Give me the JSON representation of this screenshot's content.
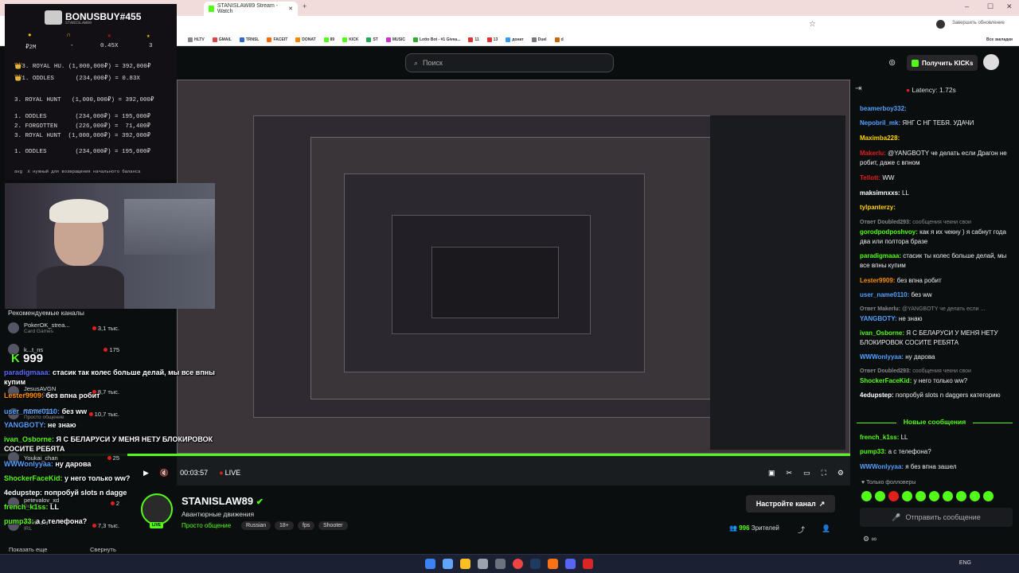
{
  "browser": {
    "active_tab": "STANISLAW89 Stream - Watch",
    "update_label": "Завершить обновление",
    "bookmarks": [
      "HLTV",
      "GMAIL",
      "TRNSL",
      "FACEIT",
      "DONAT",
      "89",
      "KICK",
      "ST",
      "MUSIC",
      "Lotto Bot - #1 Givea...",
      "11",
      "13",
      "донат",
      "Duel",
      "d"
    ],
    "all_bookmarks": "Все закладки"
  },
  "header": {
    "search_placeholder": "Поиск",
    "kicks_button": "Получить KICKs"
  },
  "bonus": {
    "title": "BONUSBUY#455",
    "subtitle": "STANISLAW89",
    "stats": [
      "₽2M",
      "-",
      "0.45X",
      "3"
    ],
    "rows": [
      "👑3. ROYAL HU. (1,000,000₽) = 392,000₽",
      "👑1. ODDLES      (234,000₽) = 0.83X",
      "3. ROYAL HUNT   (1,000,000₽) = 392,000₽",
      "1. ODDLES        (234,000₽) = 195,000₽",
      "2. FORGOTTEN     (226,000₽) =  71,400₽",
      "3. ROYAL HUNT  (1,000,000₽) = 392,000₽",
      "1. ODDLES        (234,000₽) = 195,000₽"
    ],
    "footer": "avg  X нужный для возвращения начального баланса"
  },
  "sidebar": {
    "heading": "Рекомендуемые каналы",
    "channels": [
      {
        "name": "PokerOK_strea...",
        "category": "Card Games",
        "viewers": "3,1 тыс."
      },
      {
        "name": "k...t_ns",
        "category": "",
        "viewers": "175"
      },
      {
        "name": "999",
        "category": "",
        "viewers": ""
      },
      {
        "name": "JesusAVGN",
        "category": "Slots & Casino",
        "viewers": "8,7 тыс."
      },
      {
        "name": "ROSHTEIN",
        "category": "Просто общение",
        "viewers": "10,7 тыс."
      },
      {
        "name": "Youkai_chan",
        "category": "",
        "viewers": "25"
      },
      {
        "name": "petevalov_xd",
        "category": "Dota 2",
        "viewers": "2"
      },
      {
        "name": "clavicular",
        "category": "IRL",
        "viewers": "7,3 тыс."
      }
    ],
    "show_more": "Показать еще",
    "collapse": "Свернуть"
  },
  "overlay_chat": [
    {
      "user": "paradigmaaa:",
      "text": "стасик так колес больше делай, мы все впны купим"
    },
    {
      "user": "Lester9909:",
      "text": "без впна робит"
    },
    {
      "user": "user_name0110:",
      "text": "без ww"
    },
    {
      "user": "YANGBOTY:",
      "text": "не знаю"
    },
    {
      "user": "ivan_Osborne:",
      "text": "Я С БЕЛАРУСИ У МЕНЯ НЕТУ БЛОКИРОВОК СОСИТЕ РЕБЯТА"
    },
    {
      "user": "WWWonlyyaa:",
      "text": "ну дарова"
    },
    {
      "user": "ShockerFaceKid:",
      "text": "у него только ww?"
    },
    {
      "user": "4edupstep:",
      "text": "попробуй slots n daggers категорию"
    },
    {
      "user": "french_k1ss:",
      "text": "LL"
    },
    {
      "user": "pump33:",
      "text": "а с телефона?"
    }
  ],
  "player": {
    "time": "00:03:57",
    "live": "LIVE"
  },
  "channel": {
    "name": "STANISLAW89",
    "live_badge": "LIVE",
    "title": "Авантюрные движения",
    "category": "Просто общение",
    "tags": [
      "Russian",
      "18+",
      "fps",
      "Shooter"
    ],
    "setup_button": "Настройте канал",
    "viewers": "996",
    "viewers_label": "Зрителей"
  },
  "chat": {
    "latency": "Latency: 1.72s",
    "messages": [
      {
        "user": "beamerboy332:",
        "text": "",
        "color": "#53a0ff"
      },
      {
        "user": "Nepobril_mk:",
        "text": "ЯНГ С НГ ТЕБЯ. УДАЧИ",
        "color": "#53a0ff"
      },
      {
        "user": "Maximba228:",
        "text": "",
        "color": "#ffd400"
      },
      {
        "user": "Makerlu:",
        "text": "@YANGBOTY че делать если Драгон не робит, даже с впном",
        "color": "#e01f1f"
      },
      {
        "user": "Tellott:",
        "text": "WW",
        "color": "#e01f1f"
      },
      {
        "user": "maksimnxxs:",
        "text": "LL",
        "color": "#ffffff"
      },
      {
        "user": "tylpanterzy:",
        "text": "",
        "color": "#ffd400"
      },
      {
        "user": "Ответ Doubled293:",
        "text": "сообщения чекни свои",
        "color": "#888888"
      },
      {
        "user": "gorodpodposhvoy:",
        "text": "как я их чекну ) я сабнут года два или полтора брaзе",
        "color": "#53fc18"
      },
      {
        "user": "paradigmaaa:",
        "text": "стасик ты колес больше делай, мы все впны купим",
        "color": "#53fc18"
      },
      {
        "user": "Lester9909:",
        "text": "без впна робит",
        "color": "#ff8c00"
      },
      {
        "user": "user_name0110:",
        "text": "без ww",
        "color": "#53a0ff"
      },
      {
        "user": "Ответ Makerlu:",
        "text": "@YANGBOTY че делать если ...",
        "color": "#888888"
      },
      {
        "user": "YANGBOTY:",
        "text": "не знаю",
        "color": "#53a0ff"
      },
      {
        "user": "ivan_Osborne:",
        "text": "Я С БЕЛАРУСИ У МЕНЯ НЕТУ БЛОКИРОВОК СОСИТЕ РЕБЯТА",
        "color": "#53fc18"
      },
      {
        "user": "WWWonlyyaa:",
        "text": "ну дарова",
        "color": "#53a0ff"
      },
      {
        "user": "Ответ Doubled293:",
        "text": "сообщения чекни свои",
        "color": "#888888"
      },
      {
        "user": "ShockerFaceKid:",
        "text": "у него только ww?",
        "color": "#53fc18"
      },
      {
        "user": "4edupstep:",
        "text": "попробуй slots n daggers категорию",
        "color": "#ffffff"
      }
    ],
    "new_messages": "Новые сообщения",
    "after_messages": [
      {
        "user": "french_k1ss:",
        "text": "LL",
        "color": "#53fc18"
      },
      {
        "user": "pump33:",
        "text": "а с телефона?",
        "color": "#53fc18"
      },
      {
        "user": "WWWonlyyaa:",
        "text": "я без впна зашел",
        "color": "#53a0ff"
      }
    ],
    "followers_only": "Только фолловеры",
    "input_placeholder": "Отправить сообщение"
  },
  "taskbar": {
    "lang": "ENG"
  }
}
